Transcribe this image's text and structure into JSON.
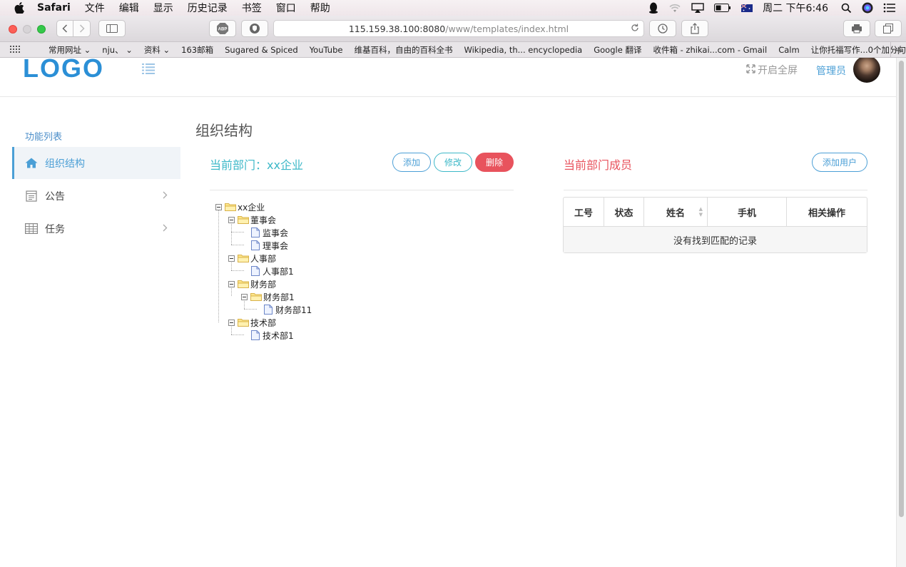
{
  "menubar": {
    "app": "Safari",
    "items": [
      "文件",
      "编辑",
      "显示",
      "历史记录",
      "书签",
      "窗口",
      "帮助"
    ],
    "clock": "周二 下午6:46"
  },
  "browser": {
    "url_host": "115.159.38.100:8080",
    "url_path": "/www/templates/index.html",
    "bookmarks": [
      "常用网址 ⌄",
      "nju、 ⌄",
      "资料 ⌄",
      "163邮箱",
      "Sugared & Spiced",
      "YouTube",
      "维基百科，自由的百科全书",
      "Wikipedia, th... encyclopedia",
      "Google 翻译",
      "收件箱 - zhikai...com - Gmail",
      "Calm",
      "让你托福写作...0个加分句子"
    ]
  },
  "header": {
    "logo": "LOGO",
    "fullscreen_label": "开启全屏",
    "admin_label": "管理员"
  },
  "sidebar": {
    "title": "功能列表",
    "items": [
      {
        "label": "组织结构",
        "icon": "home-icon"
      },
      {
        "label": "公告",
        "icon": "notice-icon"
      },
      {
        "label": "任务",
        "icon": "table-icon"
      }
    ]
  },
  "main": {
    "page_title": "组织结构",
    "dept_label": "当前部门：xx企业",
    "buttons": {
      "add": "添加",
      "edit": "修改",
      "delete": "删除"
    },
    "tree": {
      "root": "xx企业",
      "nodes": [
        "董事会",
        "监事会",
        "理事会",
        "人事部",
        "人事部1",
        "财务部",
        "财务部1",
        "财务部11",
        "技术部",
        "技术部1"
      ]
    },
    "members": {
      "label": "当前部门成员",
      "add_user": "添加用户",
      "columns": [
        "工号",
        "状态",
        "姓名",
        "手机",
        "相关操作"
      ],
      "empty": "没有找到匹配的记录"
    }
  },
  "colors": {
    "accent_blue": "#4b9fd6",
    "teal": "#3db8c8",
    "danger": "#e8535d"
  }
}
